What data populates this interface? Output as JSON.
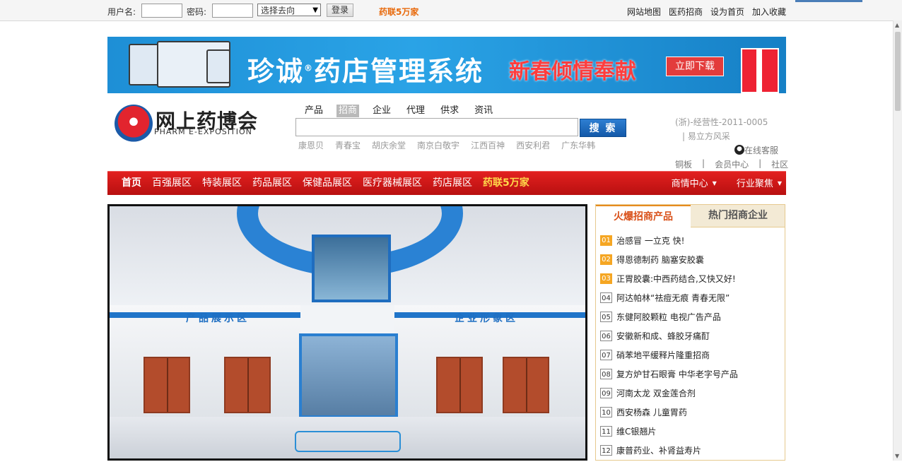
{
  "topbar": {
    "username_label": "用户名:",
    "password_label": "密码:",
    "select_value": "选择去向",
    "login_label": "登录",
    "hot_link": "药联5万家",
    "links": [
      "网站地图",
      "医药招商",
      "设为首页",
      "加入收藏"
    ]
  },
  "banner": {
    "title": "珍诚",
    "title_rest": "药店管理系统",
    "registered": "®",
    "promo": "新春倾情奉献",
    "download": "立即下载",
    "monitor_caption": "药店管理系统"
  },
  "logo": {
    "cn": "网上药博会",
    "en": "PHARM  E-EXPOSITION"
  },
  "search": {
    "tabs": [
      "产品",
      "招商",
      "企业",
      "代理",
      "供求",
      "资讯"
    ],
    "active_tab": "招商",
    "button": "搜 索",
    "hot_words": [
      "康恩贝",
      "青春宝",
      "胡庆余堂",
      "南京白敬宇",
      "江西百神",
      "西安利君",
      "广东华韩"
    ]
  },
  "header_info": {
    "license": "(浙)-经营性-2011-0005",
    "partner": "|  易立方风采",
    "service": "在线客服",
    "links": [
      "铜板",
      "|",
      "会员中心",
      "|",
      "社区"
    ]
  },
  "nav": {
    "items": [
      "首页",
      "百强展区",
      "特装展区",
      "药品展区",
      "保健品展区",
      "医疗器械展区",
      "药店展区",
      "药联5万家"
    ],
    "right": [
      "商情中心",
      "行业聚焦"
    ]
  },
  "hero": {
    "left_label": "产品展示区",
    "right_label": "企业形象区"
  },
  "panel": {
    "tabs": [
      "火爆招商产品",
      "热门招商企业"
    ],
    "items": [
      {
        "num": "01",
        "text": "治感冒 一立克 快!"
      },
      {
        "num": "02",
        "text": "得恩德制药 脑塞安胶囊"
      },
      {
        "num": "03",
        "text": "正胃胶囊:中西药结合,又快又好!"
      },
      {
        "num": "04",
        "text": "阿达帕林“祛痘无痕 青春无限”"
      },
      {
        "num": "05",
        "text": "东健阿胶颗粒 电视广告产品"
      },
      {
        "num": "06",
        "text": "安徽新和成、蜂胶牙痛酊"
      },
      {
        "num": "07",
        "text": "硝苯地平缓释片隆重招商"
      },
      {
        "num": "08",
        "text": "复方炉甘石眼膏 中华老字号产品"
      },
      {
        "num": "09",
        "text": "河南太龙 双金莲合剂"
      },
      {
        "num": "10",
        "text": "西安杨森 儿童胃药"
      },
      {
        "num": "11",
        "text": "维C银翘片"
      },
      {
        "num": "12",
        "text": "康普药业、补肾益寿片"
      }
    ]
  },
  "colors": {
    "nav_red": "#c81515",
    "accent_orange": "#e86a0c",
    "highlight_yellow": "#ffd84a",
    "search_blue": "#1a68bd"
  }
}
